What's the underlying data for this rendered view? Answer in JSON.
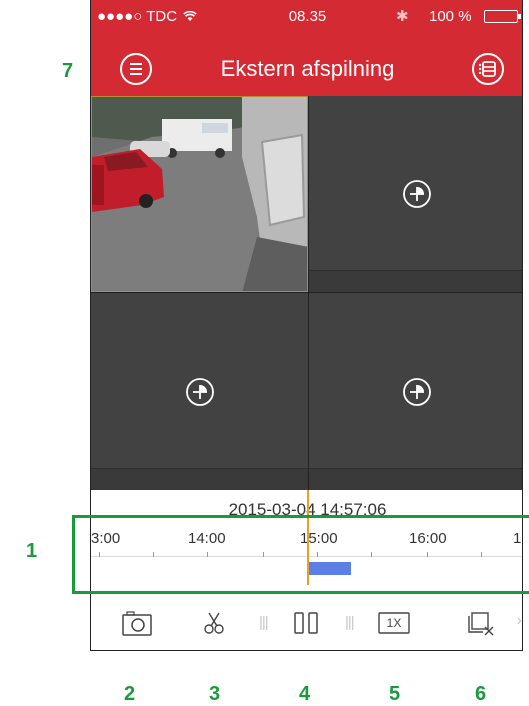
{
  "callouts": {
    "c1": "1",
    "c2": "2",
    "c3": "3",
    "c4": "4",
    "c5": "5",
    "c6": "6",
    "c7": "7"
  },
  "status_bar": {
    "carrier": "●●●●○ TDC",
    "time": "08.35",
    "battery": "100 %"
  },
  "header": {
    "title": "Ekstern afspilning"
  },
  "icons": {
    "menu": "menu-icon",
    "device_list": "device-list-icon",
    "add_camera": "add-camera-icon",
    "snapshot": "camera-icon",
    "clip": "scissors-icon",
    "pause": "pause-icon",
    "close_window": "close-window-icon"
  },
  "timeline": {
    "datetime": "2015-03-04  14:57:06",
    "labels": [
      "3:00",
      "14:00",
      "15:00",
      "16:00",
      "1"
    ]
  },
  "toolbar": {
    "speed": "1X",
    "more": "›"
  },
  "colors": {
    "header_red": "#d42a34",
    "callout_green": "#1a9a3a",
    "playhead": "#e9a21d",
    "recording": "#5c7fe6"
  }
}
